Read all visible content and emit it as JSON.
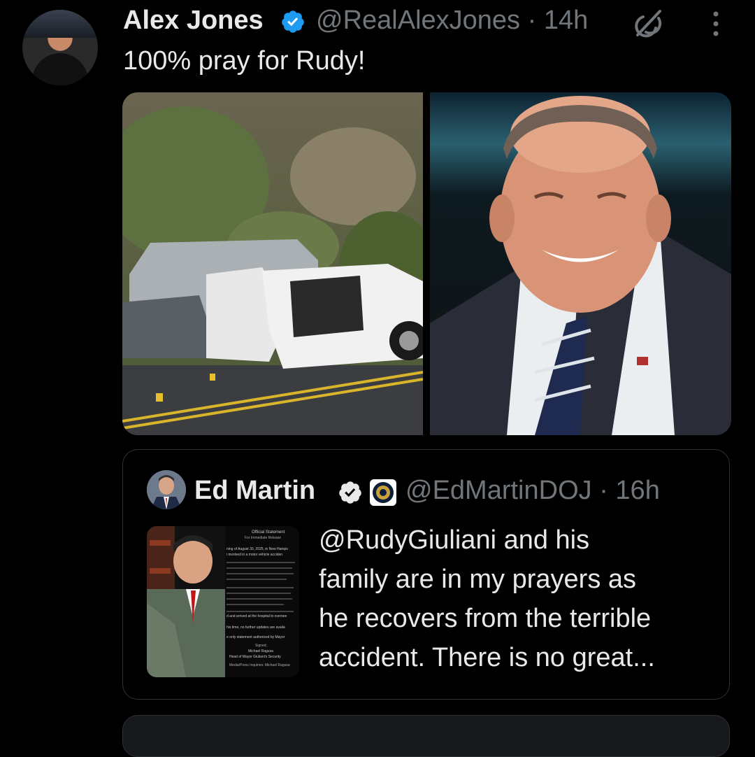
{
  "tweet": {
    "author_name": "Alex Jones",
    "handle": "@RealAlexJones",
    "time": "14h",
    "separator": "·",
    "text": "100% pray for Rudy!",
    "media": [
      {
        "kind": "photo",
        "subject": "car-crash"
      },
      {
        "kind": "photo",
        "subject": "portrait"
      }
    ]
  },
  "quote": {
    "author_name": "Ed Martin",
    "handle": "@EdMartinDOJ",
    "time": "16h",
    "separator": "·",
    "text_lines": [
      "@RudyGiuliani and his",
      "family are in my prayers as",
      "he recovers from the terrible",
      "accident. There is no great..."
    ],
    "thumbnail": {
      "heading": "Official Statement",
      "subheading": "For Immediate Release",
      "paragraphs": [
        "ning of August 30, 2025, in New Hamps",
        "i involved in a motor vehicle acciden",
        "d and arrived at the hospital to oversee",
        "his time, no further updates are availa",
        "e only statement authorized by Mayor"
      ],
      "signed": "Signed,",
      "signer": "Michael Ragusa",
      "signer_title": "Head of Mayor Giuliani's Security",
      "contact": "Media/Press Inquiries: Michael Ragusa"
    }
  },
  "icons": {
    "verified": "verified-badge-icon",
    "grok": "grok-icon",
    "more": "more-vertical-icon",
    "seal": "doj-seal-icon"
  },
  "colors": {
    "background": "#000000",
    "text_primary": "#e7e9ea",
    "text_secondary": "#71767b",
    "verified_blue": "#1d9bf0",
    "border": "#2f3336"
  }
}
